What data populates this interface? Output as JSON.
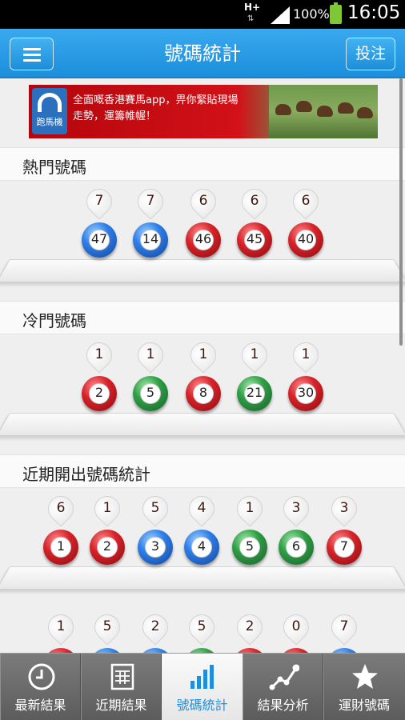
{
  "status_bar": {
    "network": "H+",
    "battery": "100%",
    "time": "16:05"
  },
  "header": {
    "title": "號碼統計",
    "bet_button": "投注",
    "menu_icon": "hamburger-menu-icon"
  },
  "ad": {
    "logo_text": "跑馬機",
    "line1": "全面嘅香港賽馬app，畀你緊貼現場",
    "line2": "走勢，運籌帷幄！"
  },
  "sections": [
    {
      "title": "熱門號碼",
      "balls": [
        {
          "count": "7",
          "number": "47",
          "color": "blue"
        },
        {
          "count": "7",
          "number": "14",
          "color": "blue"
        },
        {
          "count": "6",
          "number": "46",
          "color": "red"
        },
        {
          "count": "6",
          "number": "45",
          "color": "red"
        },
        {
          "count": "6",
          "number": "40",
          "color": "red"
        }
      ]
    },
    {
      "title": "冷門號碼",
      "balls": [
        {
          "count": "1",
          "number": "2",
          "color": "red"
        },
        {
          "count": "1",
          "number": "5",
          "color": "green"
        },
        {
          "count": "1",
          "number": "8",
          "color": "red"
        },
        {
          "count": "1",
          "number": "21",
          "color": "green"
        },
        {
          "count": "1",
          "number": "30",
          "color": "red"
        }
      ]
    },
    {
      "title": "近期開出號碼統計",
      "rows": [
        [
          {
            "count": "6",
            "number": "1",
            "color": "red"
          },
          {
            "count": "1",
            "number": "2",
            "color": "red"
          },
          {
            "count": "5",
            "number": "3",
            "color": "blue"
          },
          {
            "count": "4",
            "number": "4",
            "color": "blue"
          },
          {
            "count": "1",
            "number": "5",
            "color": "green"
          },
          {
            "count": "3",
            "number": "6",
            "color": "green"
          },
          {
            "count": "3",
            "number": "7",
            "color": "red"
          }
        ],
        [
          {
            "count": "1",
            "number": "",
            "color": "red"
          },
          {
            "count": "5",
            "number": "",
            "color": "blue"
          },
          {
            "count": "2",
            "number": "",
            "color": "blue"
          },
          {
            "count": "5",
            "number": "",
            "color": "green"
          },
          {
            "count": "2",
            "number": "",
            "color": "red"
          },
          {
            "count": "0",
            "number": "",
            "color": "red"
          },
          {
            "count": "7",
            "number": "",
            "color": "blue"
          }
        ]
      ]
    }
  ],
  "bottom_nav": [
    {
      "label": "最新結果",
      "icon": "clock-icon",
      "active": false
    },
    {
      "label": "近期結果",
      "icon": "calendar-grid-icon",
      "active": false
    },
    {
      "label": "號碼統計",
      "icon": "bar-chart-icon",
      "active": true
    },
    {
      "label": "結果分析",
      "icon": "line-chart-icon",
      "active": false
    },
    {
      "label": "運財號碼",
      "icon": "star-icon",
      "active": false
    }
  ],
  "colors": {
    "accent": "#1f8fdc",
    "red_ball": "#d6232a",
    "blue_ball": "#2f7ee6",
    "green_ball": "#2f9e44"
  }
}
